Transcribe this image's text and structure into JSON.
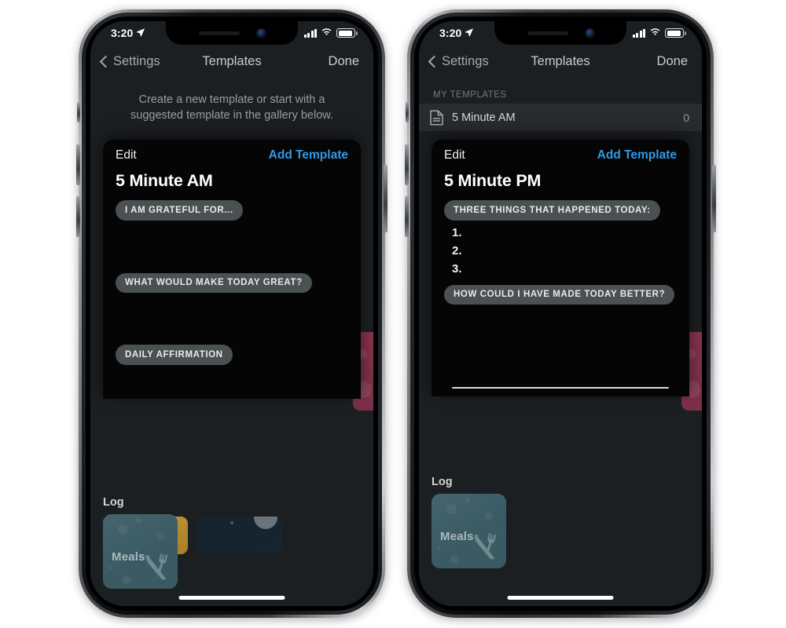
{
  "phones": [
    {
      "id": "left",
      "status_bar": {
        "time": "3:20",
        "location_icon": "location-arrow-icon",
        "signal_icon": "cellular-bars-icon",
        "wifi_icon": "wifi-icon",
        "battery_icon": "battery-icon"
      },
      "nav": {
        "back_label": "Settings",
        "title": "Templates",
        "done_label": "Done"
      },
      "empty_message": "Create a new template or start with a suggested template in the gallery below.",
      "modal": {
        "edit_label": "Edit",
        "add_label": "Add Template",
        "title": "5 Minute AM",
        "chips": [
          "I AM GRATEFUL FOR...",
          "WHAT WOULD MAKE TODAY GREAT?",
          "DAILY AFFIRMATION"
        ],
        "numbered_items": []
      },
      "log": {
        "title": "Log",
        "card_label": "Meals",
        "card_icon": "utensils-icon"
      },
      "gallery_peek": [
        "gold-card",
        "navy-moon-card",
        "crimson-card"
      ]
    },
    {
      "id": "right",
      "status_bar": {
        "time": "3:20",
        "location_icon": "location-arrow-icon",
        "signal_icon": "cellular-bars-icon",
        "wifi_icon": "wifi-icon",
        "battery_icon": "battery-icon"
      },
      "nav": {
        "back_label": "Settings",
        "title": "Templates",
        "done_label": "Done"
      },
      "section_header": "MY TEMPLATES",
      "template_row": {
        "icon": "document-icon",
        "name": "5 Minute AM",
        "count": "0"
      },
      "modal": {
        "edit_label": "Edit",
        "add_label": "Add Template",
        "title": "5 Minute PM",
        "chips": [
          "THREE THINGS THAT HAPPENED TODAY:",
          "HOW COULD I HAVE MADE TODAY BETTER?"
        ],
        "numbered_items": [
          "1.",
          "2.",
          "3."
        ]
      },
      "log": {
        "title": "Log",
        "card_label": "Meals",
        "card_icon": "utensils-icon"
      },
      "gallery_peek": [
        "crimson-card"
      ]
    }
  ],
  "colors": {
    "screen_bg": "#1c1f22",
    "modal_bg": "#050505",
    "accent_blue": "#2e9ae8",
    "chip_bg": "#4b5053",
    "meals_teal": "#3d5e67",
    "gold": "#c79a34",
    "navy": "#152330",
    "crimson": "#8a3550"
  }
}
